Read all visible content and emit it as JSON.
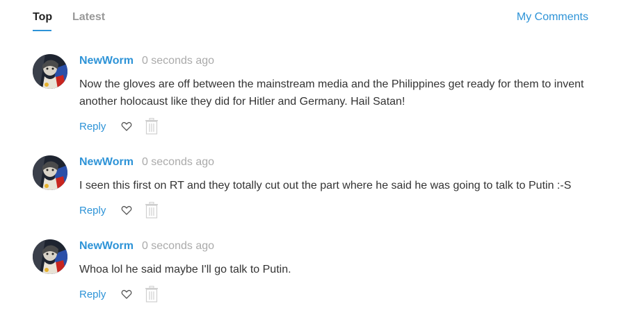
{
  "tabs": {
    "top_label": "Top",
    "latest_label": "Latest",
    "my_comments_label": "My Comments"
  },
  "comments": [
    {
      "author": "NewWorm",
      "time": "0 seconds ago",
      "text": "Now the gloves are off between the mainstream media and the Philippines get ready for them to invent another holocaust like they did for Hitler and Germany. Hail Satan!",
      "reply_label": "Reply",
      "like_icon": "heart-outline-icon",
      "delete_icon": "trash-icon"
    },
    {
      "author": "NewWorm",
      "time": "0 seconds ago",
      "text": "I seen this first on RT and they totally cut out the part where he said he was going to talk to Putin :-S",
      "reply_label": "Reply",
      "like_icon": "heart-outline-icon",
      "delete_icon": "trash-icon"
    },
    {
      "author": "NewWorm",
      "time": "0 seconds ago",
      "text": "Whoa lol he said maybe I'll go talk to Putin.",
      "reply_label": "Reply",
      "like_icon": "heart-outline-icon",
      "delete_icon": "trash-icon"
    }
  ],
  "colors": {
    "accent": "#2d93d7",
    "muted": "#aaaaaa",
    "text": "#333333"
  }
}
